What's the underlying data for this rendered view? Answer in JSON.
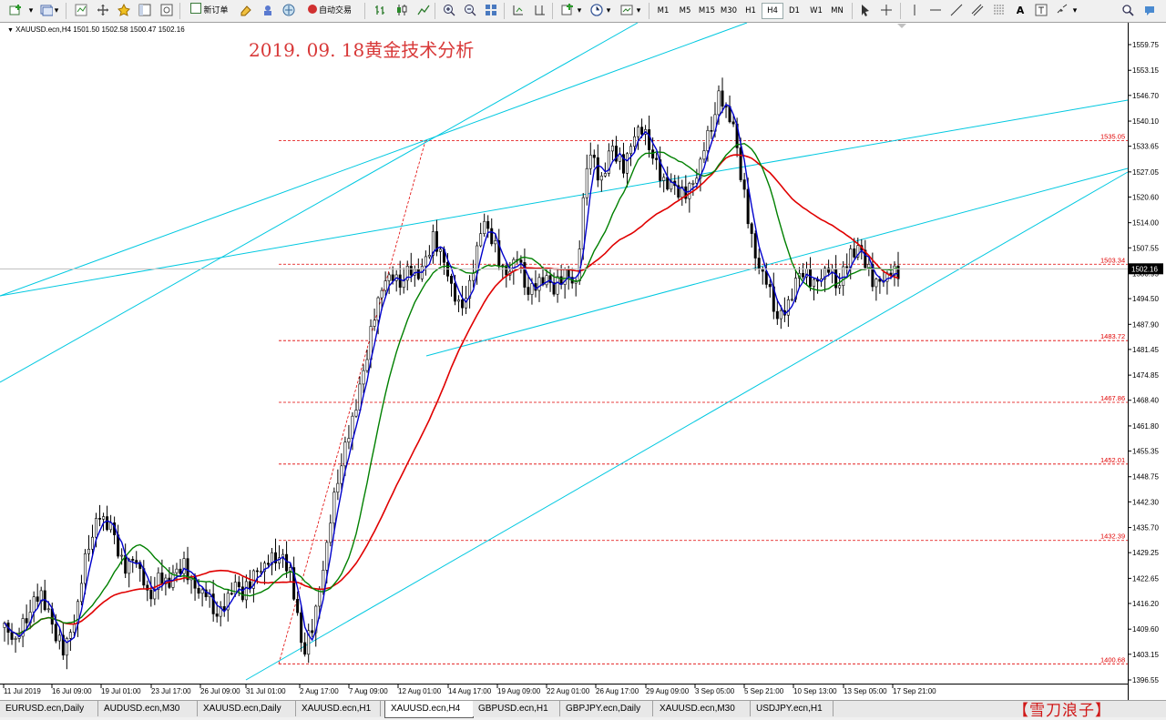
{
  "toolbar": {
    "new_order_label": "新订单",
    "auto_trading_label": "自动交易",
    "timeframes": [
      "M1",
      "M5",
      "M15",
      "M30",
      "H1",
      "H4",
      "D1",
      "W1",
      "MN"
    ],
    "active_timeframe": "H4",
    "icons": [
      "new-chart-icon",
      "profiles-icon",
      "market-watch-icon",
      "navigator-icon",
      "data-window-icon",
      "terminal-icon",
      "strategy-tester-icon",
      "new-order-icon",
      "metaeditor-icon",
      "signals-icon",
      "market-icon",
      "auto-trading-icon",
      "bar-chart-icon",
      "candlestick-icon",
      "line-chart-icon",
      "zoom-in-icon",
      "zoom-out-icon",
      "tile-windows-icon",
      "autoscroll-icon",
      "chart-shift-icon",
      "indicators-icon",
      "periods-icon",
      "templates-icon",
      "cursor-icon",
      "crosshair-icon",
      "horizontal-line-icon",
      "trendline-icon",
      "fibonacci-icon",
      "channel-icon",
      "text-icon",
      "text-label-icon",
      "arrows-icon",
      "search-icon",
      "community-icon"
    ]
  },
  "chart": {
    "symbol_info": "XAUUSD.ecn,H4  1501.50 1502.58 1500.47 1502.16",
    "title": "2019. 09. 18黄金技术分析",
    "current_price": "1502.16",
    "price_scale": [
      "1559.75",
      "1553.15",
      "1546.70",
      "1540.10",
      "1533.65",
      "1527.05",
      "1520.60",
      "1514.00",
      "1507.55",
      "1500.95",
      "1494.50",
      "1487.90",
      "1481.45",
      "1474.85",
      "1468.40",
      "1461.80",
      "1455.35",
      "1448.75",
      "1442.30",
      "1435.70",
      "1429.25",
      "1422.65",
      "1416.20",
      "1409.60",
      "1403.15",
      "1396.55"
    ],
    "levels": [
      {
        "label": "1535.05",
        "price": 1535.05
      },
      {
        "label": "1503.34",
        "price": 1503.34
      },
      {
        "label": "1483.72",
        "price": 1483.72
      },
      {
        "label": "1467.86",
        "price": 1467.86
      },
      {
        "label": "1452.01",
        "price": 1452.01
      },
      {
        "label": "1432.39",
        "price": 1432.39
      },
      {
        "label": "1400.68",
        "price": 1400.68
      }
    ],
    "time_labels": [
      "11 Jul 2019",
      "16 Jul 09:00",
      "19 Jul 01:00",
      "23 Jul 17:00",
      "26 Jul 09:00",
      "31 Jul 01:00",
      "2 Aug 17:00",
      "7 Aug 09:00",
      "12 Aug 01:00",
      "14 Aug 17:00",
      "19 Aug 09:00",
      "22 Aug 01:00",
      "26 Aug 17:00",
      "29 Aug 09:00",
      "3 Sep 05:00",
      "5 Sep 21:00",
      "10 Sep 13:00",
      "13 Sep 05:00",
      "17 Sep 21:00"
    ],
    "colors": {
      "candles": "#000000",
      "ma_fast": "#0000cc",
      "ma_mid": "#008000",
      "ma_slow": "#e00000",
      "trendlines": "#00c8e0",
      "levels": "#e00000"
    }
  },
  "chart_data": {
    "type": "candlestick",
    "series": [
      {
        "name": "close",
        "values": [
          1410,
          1406,
          1415,
          1420,
          1409,
          1404,
          1413,
          1432,
          1440,
          1434,
          1425,
          1428,
          1418,
          1424,
          1421,
          1426,
          1420,
          1418,
          1414,
          1420,
          1418,
          1424,
          1426,
          1430,
          1425,
          1402,
          1412,
          1430,
          1450,
          1462,
          1472,
          1490,
          1500,
          1499,
          1503,
          1500,
          1510,
          1503,
          1492,
          1498,
          1513,
          1509,
          1500,
          1505,
          1497,
          1500,
          1496,
          1501,
          1498,
          1535,
          1525,
          1532,
          1528,
          1538,
          1536,
          1527,
          1522,
          1521,
          1525,
          1536,
          1548,
          1540,
          1522,
          1505,
          1498,
          1490,
          1495,
          1501,
          1498,
          1502,
          1499,
          1507,
          1505,
          1498,
          1500,
          1502
        ]
      }
    ]
  },
  "tabs": [
    "EURUSD.ecn,Daily",
    "AUDUSD.ecn,M30",
    "XAUUSD.ecn,Daily",
    "XAUUSD.ecn,H1",
    "XAUUSD.ecn,H4",
    "GBPUSD.ecn,H1",
    "GBPJPY.ecn,Daily",
    "XAUUSD.ecn,M30",
    "USDJPY.ecn,H1"
  ],
  "active_tab": "XAUUSD.ecn,H4",
  "watermark": "【雪刀浪子】"
}
